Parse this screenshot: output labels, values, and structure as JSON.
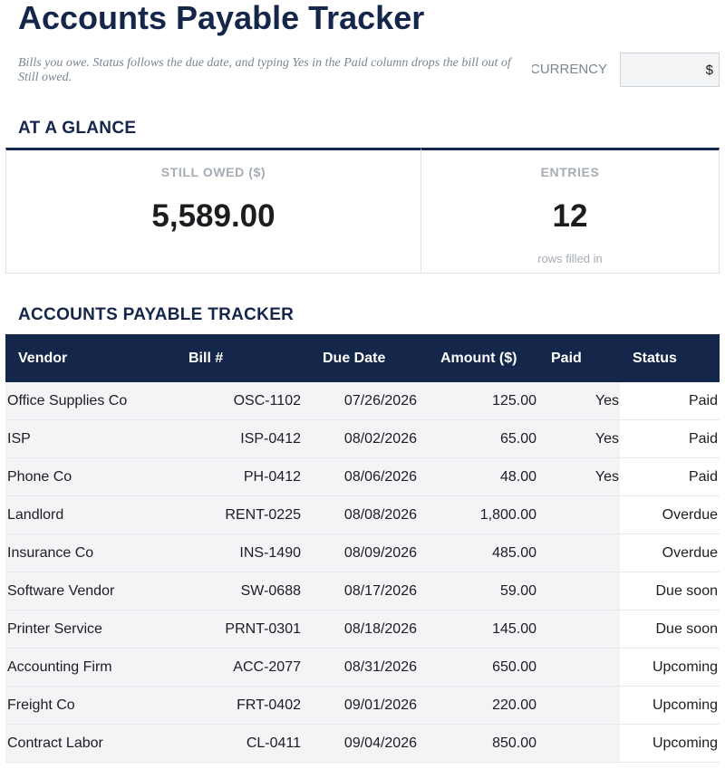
{
  "header": {
    "title": "Accounts Payable Tracker",
    "subtitle": "Bills you owe. Status follows the due date, and typing Yes in the Paid column drops the bill out of Still owed.",
    "currency_label": "CURRENCY",
    "currency_value": "$"
  },
  "glance": {
    "heading": "AT A GLANCE",
    "still_owed": {
      "label": "STILL OWED ($)",
      "value": "5,589.00"
    },
    "entries": {
      "label": "ENTRIES",
      "value": "12",
      "note": "rows filled in"
    }
  },
  "tracker": {
    "heading": "ACCOUNTS PAYABLE TRACKER",
    "columns": [
      "Vendor",
      "Bill #",
      "Due Date",
      "Amount ($)",
      "Paid",
      "Status"
    ],
    "rows": [
      {
        "vendor": "Office Supplies Co",
        "bill": "OSC-1102",
        "due": "07/26/2026",
        "amount": "125.00",
        "paid": "Yes",
        "status": "Paid"
      },
      {
        "vendor": "ISP",
        "bill": "ISP-0412",
        "due": "08/02/2026",
        "amount": "65.00",
        "paid": "Yes",
        "status": "Paid"
      },
      {
        "vendor": "Phone Co",
        "bill": "PH-0412",
        "due": "08/06/2026",
        "amount": "48.00",
        "paid": "Yes",
        "status": "Paid"
      },
      {
        "vendor": "Landlord",
        "bill": "RENT-0225",
        "due": "08/08/2026",
        "amount": "1,800.00",
        "paid": "",
        "status": "Overdue"
      },
      {
        "vendor": "Insurance Co",
        "bill": "INS-1490",
        "due": "08/09/2026",
        "amount": "485.00",
        "paid": "",
        "status": "Overdue"
      },
      {
        "vendor": "Software Vendor",
        "bill": "SW-0688",
        "due": "08/17/2026",
        "amount": "59.00",
        "paid": "",
        "status": "Due soon"
      },
      {
        "vendor": "Printer Service",
        "bill": "PRNT-0301",
        "due": "08/18/2026",
        "amount": "145.00",
        "paid": "",
        "status": "Due soon"
      },
      {
        "vendor": "Accounting Firm",
        "bill": "ACC-2077",
        "due": "08/31/2026",
        "amount": "650.00",
        "paid": "",
        "status": "Upcoming"
      },
      {
        "vendor": "Freight Co",
        "bill": "FRT-0402",
        "due": "09/01/2026",
        "amount": "220.00",
        "paid": "",
        "status": "Upcoming"
      },
      {
        "vendor": "Contract Labor",
        "bill": "CL-0411",
        "due": "09/04/2026",
        "amount": "850.00",
        "paid": "",
        "status": "Upcoming"
      }
    ]
  }
}
